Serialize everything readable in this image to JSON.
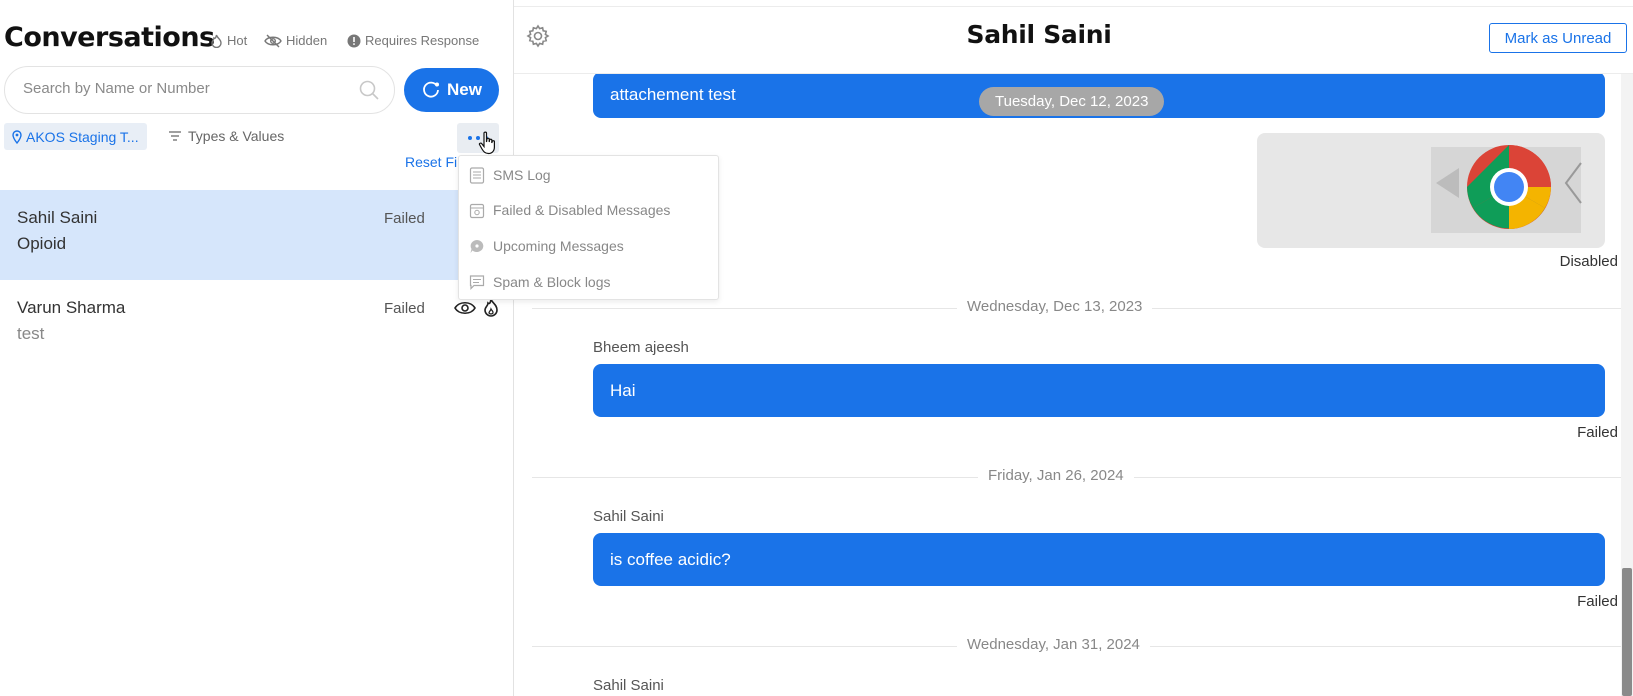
{
  "left": {
    "title": "Conversations",
    "legend": {
      "hot": "Hot",
      "hidden": "Hidden",
      "requires_response": "Requires Response"
    },
    "search": {
      "placeholder": "Search by Name or Number",
      "value": ""
    },
    "new_label": "New",
    "location_chip": "AKOS Staging T...",
    "types_filter": "Types & Values",
    "reset_label": "Reset Filters",
    "conversations": [
      {
        "name": "Sahil Saini",
        "preview": "Opioid",
        "status": "Failed",
        "active": true
      },
      {
        "name": "Varun Sharma",
        "preview": "test",
        "status": "Failed",
        "active": false
      }
    ]
  },
  "menu": {
    "items": [
      {
        "label": "SMS Log",
        "icon": "document-icon"
      },
      {
        "label": "Failed & Disabled Messages",
        "icon": "calendar-failed-icon"
      },
      {
        "label": "Upcoming Messages",
        "icon": "chat-bubble-icon"
      },
      {
        "label": "Spam & Block logs",
        "icon": "message-square-icon"
      }
    ]
  },
  "chat": {
    "title": "Sahil Saini",
    "mark_unread_label": "Mark as Unread",
    "messages": {
      "m1": {
        "text": "attachement test"
      },
      "pill_date": "Tuesday, Dec 12, 2023",
      "image_status": "Disabled",
      "d2": "Wednesday, Dec 13, 2023",
      "m2": {
        "sender": "Bheem ajeesh",
        "text": "Hai",
        "status": "Failed"
      },
      "d3": "Friday, Jan 26, 2024",
      "m3": {
        "sender": "Sahil Saini",
        "text": "is coffee acidic?",
        "status": "Failed"
      },
      "d4": "Wednesday, Jan 31, 2024",
      "m4": {
        "sender": "Sahil Saini"
      }
    }
  },
  "colors": {
    "accent": "#1a73e8",
    "active_row": "#d6e6fb",
    "date_pill": "#a7a7a7"
  }
}
